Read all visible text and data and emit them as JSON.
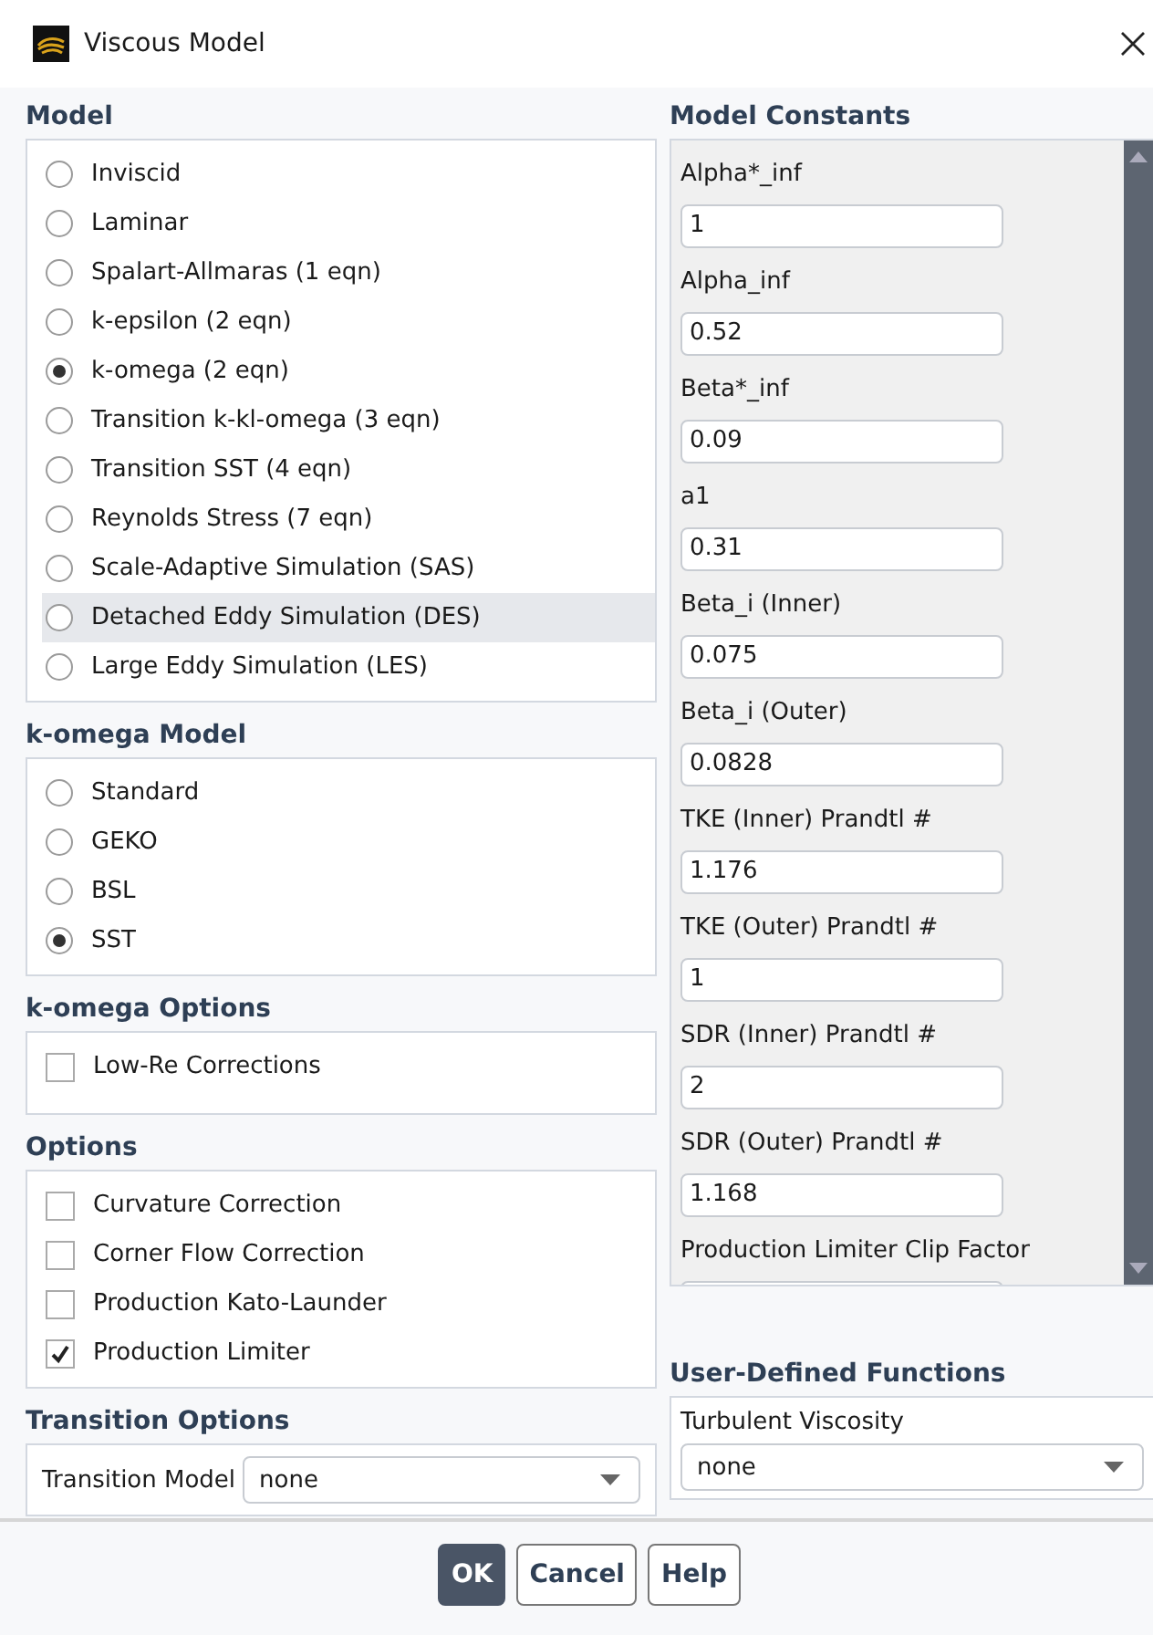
{
  "window": {
    "title": "Viscous Model"
  },
  "model": {
    "title": "Model",
    "options": [
      {
        "label": "Inviscid",
        "selected": false,
        "highlighted": false
      },
      {
        "label": "Laminar",
        "selected": false,
        "highlighted": false
      },
      {
        "label": "Spalart-Allmaras (1 eqn)",
        "selected": false,
        "highlighted": false
      },
      {
        "label": "k-epsilon (2 eqn)",
        "selected": false,
        "highlighted": false
      },
      {
        "label": "k-omega (2 eqn)",
        "selected": true,
        "highlighted": false
      },
      {
        "label": "Transition k-kl-omega (3 eqn)",
        "selected": false,
        "highlighted": false
      },
      {
        "label": "Transition SST (4 eqn)",
        "selected": false,
        "highlighted": false
      },
      {
        "label": "Reynolds Stress (7 eqn)",
        "selected": false,
        "highlighted": false
      },
      {
        "label": "Scale-Adaptive Simulation (SAS)",
        "selected": false,
        "highlighted": false
      },
      {
        "label": "Detached Eddy Simulation (DES)",
        "selected": false,
        "highlighted": true
      },
      {
        "label": "Large Eddy Simulation (LES)",
        "selected": false,
        "highlighted": false
      }
    ]
  },
  "k_omega_model": {
    "title": "k-omega Model",
    "options": [
      {
        "label": "Standard",
        "selected": false
      },
      {
        "label": "GEKO",
        "selected": false
      },
      {
        "label": "BSL",
        "selected": false
      },
      {
        "label": "SST",
        "selected": true
      }
    ]
  },
  "k_omega_options": {
    "title": "k-omega Options",
    "checks": [
      {
        "label": "Low-Re Corrections",
        "checked": false
      }
    ]
  },
  "options": {
    "title": "Options",
    "checks": [
      {
        "label": "Curvature Correction",
        "checked": false
      },
      {
        "label": "Corner Flow Correction",
        "checked": false
      },
      {
        "label": "Production Kato-Launder",
        "checked": false
      },
      {
        "label": "Production Limiter",
        "checked": true
      }
    ]
  },
  "transition_options": {
    "title": "Transition Options",
    "label": "Transition Model",
    "value": "none"
  },
  "model_constants": {
    "title": "Model Constants",
    "fields": [
      {
        "label": "Alpha*_inf",
        "value": "1"
      },
      {
        "label": "Alpha_inf",
        "value": "0.52"
      },
      {
        "label": "Beta*_inf",
        "value": "0.09"
      },
      {
        "label": "a1",
        "value": "0.31"
      },
      {
        "label": "Beta_i (Inner)",
        "value": "0.075"
      },
      {
        "label": "Beta_i (Outer)",
        "value": "0.0828"
      },
      {
        "label": "TKE (Inner) Prandtl #",
        "value": "1.176"
      },
      {
        "label": "TKE (Outer) Prandtl #",
        "value": "1"
      },
      {
        "label": "SDR (Inner) Prandtl #",
        "value": "2"
      },
      {
        "label": "SDR (Outer) Prandtl #",
        "value": "1.168"
      },
      {
        "label": "Production Limiter Clip Factor"
      }
    ]
  },
  "user_defined_functions": {
    "title": "User-Defined Functions",
    "label": "Turbulent Viscosity",
    "value": "none"
  },
  "buttons": [
    {
      "label": "OK",
      "kind": "primary"
    },
    {
      "label": "Cancel",
      "kind": "normal"
    },
    {
      "label": "Help",
      "kind": "normal"
    }
  ]
}
